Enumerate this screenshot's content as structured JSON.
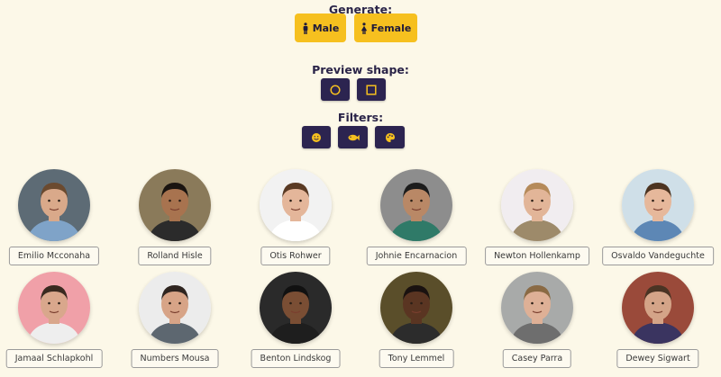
{
  "generate": {
    "title": "Generate:",
    "male_label": "Male",
    "female_label": "Female"
  },
  "preview_shape": {
    "title": "Preview shape:",
    "options": [
      "circle-icon",
      "square-icon"
    ]
  },
  "filters": {
    "title": "Filters:",
    "options": [
      "smiley-icon",
      "fish-icon",
      "palette-icon"
    ]
  },
  "colors": {
    "background": "#fcf8e8",
    "accent_yellow": "#f6c01f",
    "dark_button": "#2c2450",
    "text": "#2a2448"
  },
  "people": [
    {
      "name": "Emilio Mcconaha",
      "bg": "#5d6b75",
      "skin": "#d9a98a",
      "hair": "#6b4a2f",
      "shirt": "#7fa3c8"
    },
    {
      "name": "Rolland Hisle",
      "bg": "#8a7a5a",
      "skin": "#a8734f",
      "hair": "#1a1410",
      "shirt": "#2b2b2b"
    },
    {
      "name": "Otis Rohwer",
      "bg": "#f2f2f2",
      "skin": "#e4b69a",
      "hair": "#5a3a24",
      "shirt": "#ffffff"
    },
    {
      "name": "Johnie Encarnacion",
      "bg": "#8d8d8d",
      "skin": "#b98866",
      "hair": "#1c1c1c",
      "shirt": "#2f7a68"
    },
    {
      "name": "Newton Hollenkamp",
      "bg": "#f1edf0",
      "skin": "#e2b598",
      "hair": "#b58a5a",
      "shirt": "#9d8a6a"
    },
    {
      "name": "Osvaldo Vandeguchte",
      "bg": "#cfdfe8",
      "skin": "#e6b89b",
      "hair": "#4c3421",
      "shirt": "#5d87b5"
    },
    {
      "name": "Jamaal Schlapkohl",
      "bg": "#f0a0a8",
      "skin": "#d9a78c",
      "hair": "#3a2a20",
      "shirt": "#eeeeee"
    },
    {
      "name": "Numbers Mousa",
      "bg": "#ececec",
      "skin": "#d7a487",
      "hair": "#2f2520",
      "shirt": "#5d6770"
    },
    {
      "name": "Benton Lindskog",
      "bg": "#2a2a2a",
      "skin": "#7a4e34",
      "hair": "#111111",
      "shirt": "#1e1e1e"
    },
    {
      "name": "Tony Lemmel",
      "bg": "#5a4e2a",
      "skin": "#5a3522",
      "hair": "#1a1210",
      "shirt": "#2c2c2c"
    },
    {
      "name": "Casey Parra",
      "bg": "#a8aaa9",
      "skin": "#deb096",
      "hair": "#8a6a44",
      "shirt": "#6e6e6e"
    },
    {
      "name": "Dewey Sigwart",
      "bg": "#9a4a3a",
      "skin": "#d4a488",
      "hair": "#4a3424",
      "shirt": "#3a3460"
    }
  ]
}
